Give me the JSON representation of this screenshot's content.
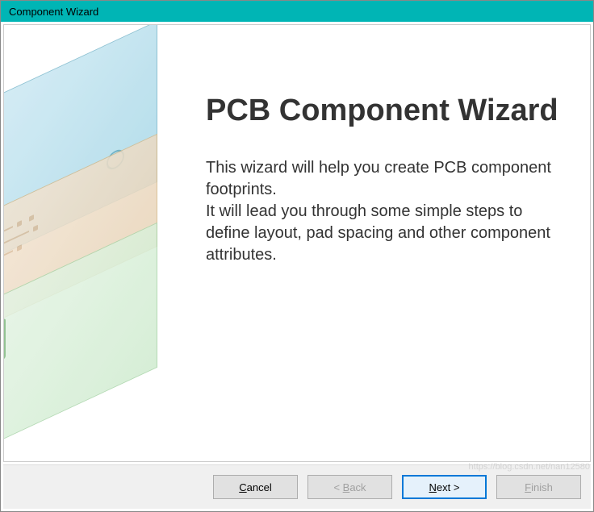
{
  "window": {
    "title": "Component Wizard"
  },
  "main": {
    "heading": "PCB Component Wizard",
    "description_line1": "This wizard will help you create PCB component footprints.",
    "description_line2": "It will lead you through some simple steps to define layout, pad spacing and other component attributes."
  },
  "buttons": {
    "cancel": "ancel",
    "cancel_key": "C",
    "back": "ack",
    "back_prefix": "< ",
    "back_key": "B",
    "next": "ext >",
    "next_key": "N",
    "finish": "inish",
    "finish_key": "F"
  },
  "watermark": "https://blog.csdn.net/nan12580"
}
